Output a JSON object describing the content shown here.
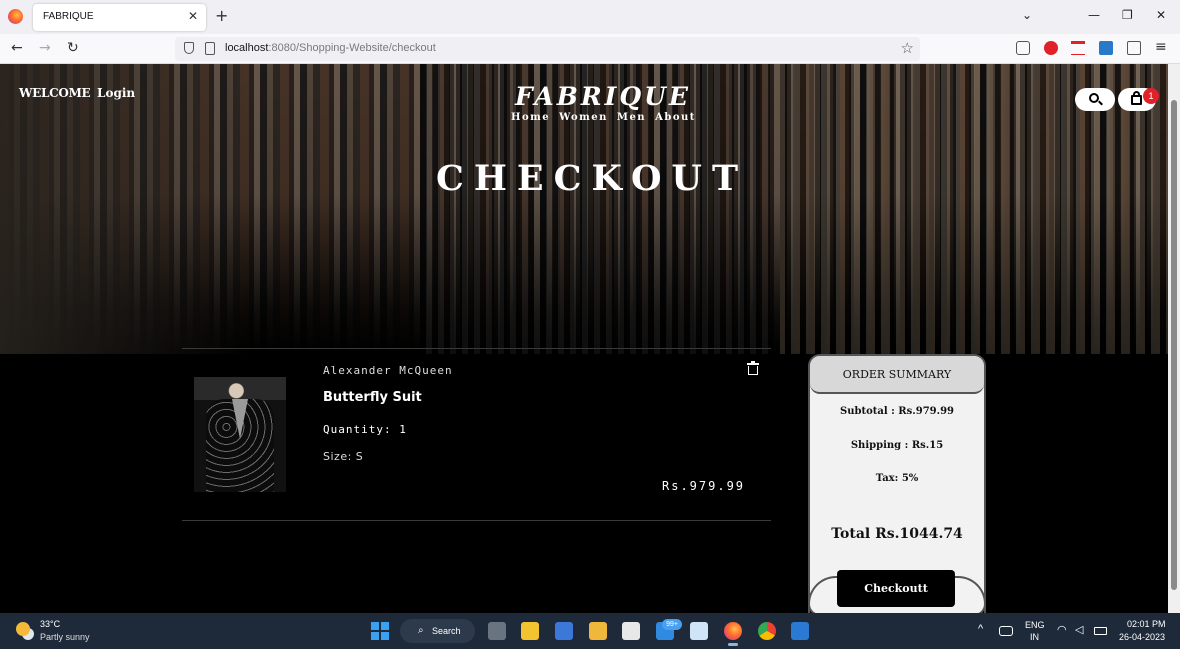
{
  "browser": {
    "tab_title": "FABRIQUE",
    "url_host": "localhost",
    "url_rest": ":8080/Shopping-Website/checkout"
  },
  "header": {
    "welcome": "WELCOME",
    "login": "Login",
    "brand": "FABRIQUE",
    "nav": [
      "Home",
      "Women",
      "Men",
      "About"
    ],
    "cart_count": "1"
  },
  "page_title": "CHECKOUT",
  "item": {
    "brand": "Alexander McQueen",
    "name": "Butterfly Suit",
    "quantity": "Quantity: 1",
    "size": "Size: S",
    "price": "Rs.979.99"
  },
  "summary": {
    "title": "ORDER SUMMARY",
    "subtotal": "Subtotal : Rs.979.99",
    "shipping": "Shipping : Rs.15",
    "tax": "Tax: 5%",
    "total": "Total Rs.1044.74",
    "checkout_label": "Checkoutt"
  },
  "taskbar": {
    "temperature": "33°C",
    "weather": "Partly sunny",
    "search": "Search",
    "mail_badge": "99+",
    "lang": "ENG",
    "region": "IN",
    "time": "02:01 PM",
    "date": "26-04-2023"
  }
}
